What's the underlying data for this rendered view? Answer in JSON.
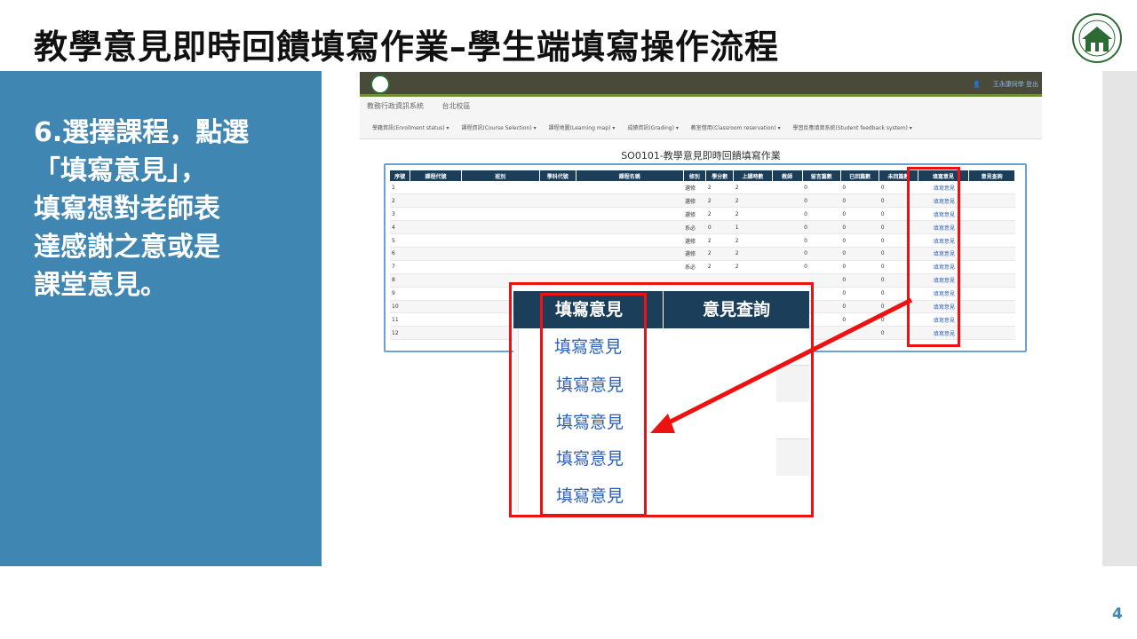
{
  "slide": {
    "title": "教學意見即時回饋填寫作業–學生端填寫操作流程",
    "step_text": "6.選擇課程，點選\n「填寫意見」，\n填寫想對老師表\n達感謝之意或是\n課堂意見。",
    "page_number": "4",
    "logo_icon": "university-seal-icon"
  },
  "screenshot": {
    "user_links": "王永康同學  登出",
    "brand": "教務行政資訊系統",
    "campus": "台北校區",
    "menu": [
      "學籍資訊(Enrollment status) ▾",
      "課程資訊(Course Selection) ▾",
      "課程地圖(Learning map) ▾",
      "成績資訊(Grading) ▾",
      "教室借用(Classroom reservation) ▾",
      "學習反應填寫系統(Student feedback system) ▾"
    ],
    "page_heading": "SO0101-教學意見即時回饋填寫作業",
    "columns": [
      "序號",
      "課程代號",
      "班別",
      "學科代號",
      "課程名稱",
      "修別",
      "學分數",
      "上課時數",
      "教師",
      "留言篇數",
      "已回篇數",
      "未回篇數",
      "填寫意見",
      "意見查詢"
    ],
    "rows": [
      {
        "no": "1",
        "type": "選修",
        "credits": "2",
        "hours": "2",
        "msgs": "0",
        "replied": "0",
        "unreplied": "0",
        "action": "填寫意見"
      },
      {
        "no": "2",
        "type": "選修",
        "credits": "2",
        "hours": "2",
        "msgs": "0",
        "replied": "0",
        "unreplied": "0",
        "action": "填寫意見"
      },
      {
        "no": "3",
        "type": "選修",
        "credits": "2",
        "hours": "2",
        "msgs": "0",
        "replied": "0",
        "unreplied": "0",
        "action": "填寫意見"
      },
      {
        "no": "4",
        "type": "系必",
        "credits": "0",
        "hours": "1",
        "msgs": "0",
        "replied": "0",
        "unreplied": "0",
        "action": "填寫意見"
      },
      {
        "no": "5",
        "type": "選修",
        "credits": "2",
        "hours": "2",
        "msgs": "0",
        "replied": "0",
        "unreplied": "0",
        "action": "填寫意見"
      },
      {
        "no": "6",
        "type": "選修",
        "credits": "2",
        "hours": "2",
        "msgs": "0",
        "replied": "0",
        "unreplied": "0",
        "action": "填寫意見"
      },
      {
        "no": "7",
        "type": "系必",
        "credits": "2",
        "hours": "2",
        "msgs": "0",
        "replied": "0",
        "unreplied": "0",
        "action": "填寫意見"
      },
      {
        "no": "8",
        "type": "",
        "credits": "",
        "hours": "",
        "msgs": "",
        "replied": "0",
        "unreplied": "0",
        "action": "填寫意見"
      },
      {
        "no": "9",
        "type": "",
        "credits": "",
        "hours": "",
        "msgs": "",
        "replied": "0",
        "unreplied": "0",
        "action": "填寫意見"
      },
      {
        "no": "10",
        "type": "",
        "credits": "",
        "hours": "",
        "msgs": "",
        "replied": "0",
        "unreplied": "0",
        "action": "填寫意見"
      },
      {
        "no": "11",
        "type": "",
        "credits": "",
        "hours": "",
        "msgs": "",
        "replied": "0",
        "unreplied": "0",
        "action": "填寫意見"
      },
      {
        "no": "12",
        "type": "",
        "credits": "",
        "hours": "",
        "msgs": "",
        "replied": "",
        "unreplied": "0",
        "action": "填寫意見"
      }
    ]
  },
  "zoom": {
    "col1": "填寫意見",
    "col2": "意見查詢",
    "links": [
      "填寫意見",
      "填寫意見",
      "填寫意見",
      "填寫意見",
      "填寫意見"
    ]
  },
  "colors": {
    "accent_blue": "#3f86b2",
    "header_navy": "#1b3e5a",
    "highlight_red": "#ee1111",
    "link_blue": "#2c5fb5"
  }
}
